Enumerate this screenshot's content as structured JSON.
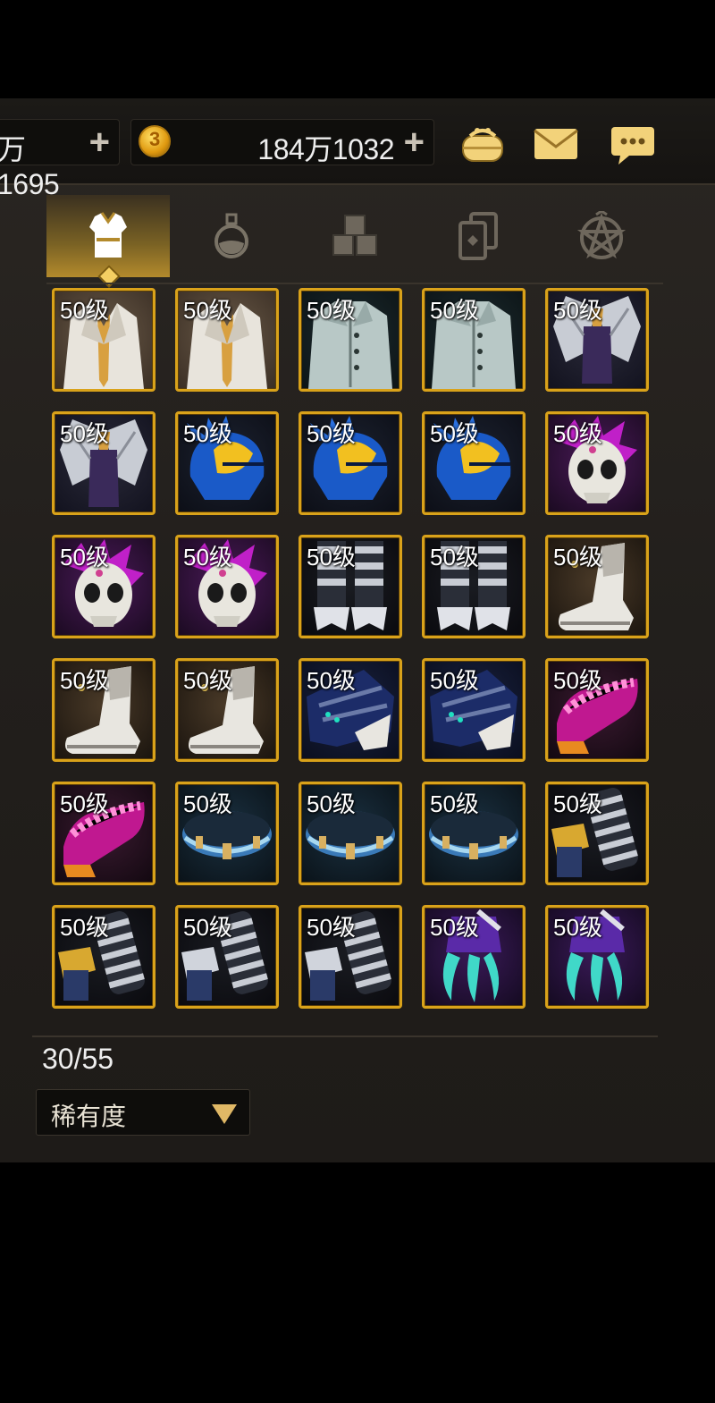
{
  "currency": {
    "first_value": "万1695",
    "second_value": "184万1032",
    "plus": "+"
  },
  "tabs": [
    {
      "name": "equipment",
      "icon": "armor-icon",
      "active": true
    },
    {
      "name": "potions",
      "icon": "potion-icon",
      "active": false
    },
    {
      "name": "materials",
      "icon": "cubes-icon",
      "active": false
    },
    {
      "name": "cards",
      "icon": "cards-icon",
      "active": false
    },
    {
      "name": "emblems",
      "icon": "pentagram-icon",
      "active": false
    }
  ],
  "items": [
    {
      "level": "50级",
      "type": "white-suit"
    },
    {
      "level": "50级",
      "type": "white-suit"
    },
    {
      "level": "50级",
      "type": "grey-coat"
    },
    {
      "level": "50级",
      "type": "grey-coat"
    },
    {
      "level": "50级",
      "type": "winged-armor"
    },
    {
      "level": "50级",
      "type": "winged-armor"
    },
    {
      "level": "50级",
      "type": "blue-helmet"
    },
    {
      "level": "50级",
      "type": "blue-helmet"
    },
    {
      "level": "50级",
      "type": "blue-helmet"
    },
    {
      "level": "50级",
      "type": "skull-mask"
    },
    {
      "level": "50级",
      "type": "skull-mask"
    },
    {
      "level": "50级",
      "type": "skull-mask"
    },
    {
      "level": "50级",
      "type": "striped-pants"
    },
    {
      "level": "50级",
      "type": "striped-pants"
    },
    {
      "level": "50级",
      "type": "white-boot"
    },
    {
      "level": "50级",
      "type": "white-boot"
    },
    {
      "level": "50级",
      "type": "white-boot"
    },
    {
      "level": "50级",
      "type": "blue-boot"
    },
    {
      "level": "50级",
      "type": "blue-boot"
    },
    {
      "level": "50级",
      "type": "pink-shoe"
    },
    {
      "level": "50级",
      "type": "pink-shoe"
    },
    {
      "level": "50级",
      "type": "blue-belt"
    },
    {
      "level": "50级",
      "type": "blue-belt"
    },
    {
      "level": "50级",
      "type": "blue-belt"
    },
    {
      "level": "50级",
      "type": "gold-gauntlet"
    },
    {
      "level": "50级",
      "type": "gold-gauntlet"
    },
    {
      "level": "50级",
      "type": "silver-gauntlet"
    },
    {
      "level": "50级",
      "type": "silver-gauntlet"
    },
    {
      "level": "50级",
      "type": "claw-glove"
    },
    {
      "level": "50级",
      "type": "claw-glove"
    }
  ],
  "capacity": "30/55",
  "sort": {
    "label": "稀有度"
  },
  "colors": {
    "accent": "#d9a21a",
    "tab_active": "#b38a2c",
    "panel": "#24211d"
  }
}
